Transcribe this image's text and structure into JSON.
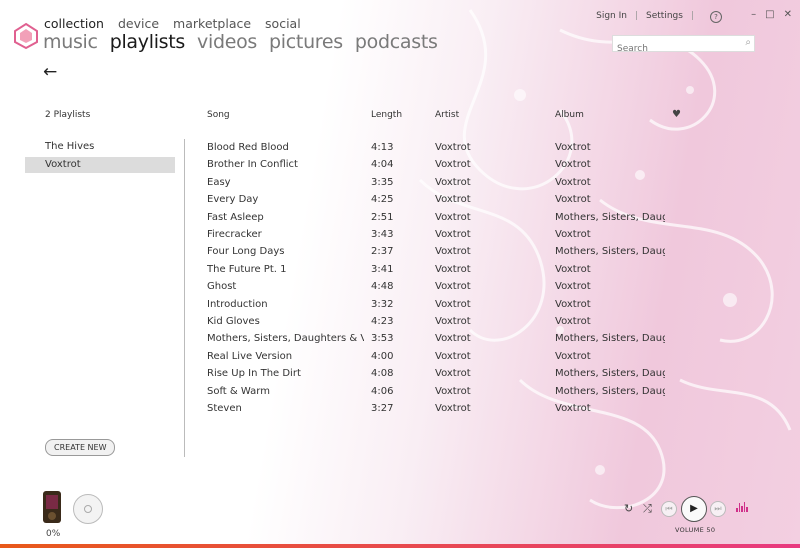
{
  "nav": {
    "pivots": [
      "collection",
      "device",
      "marketplace",
      "social"
    ],
    "subpivots": [
      "music",
      "playlists",
      "videos",
      "pictures",
      "podcasts"
    ],
    "sign_in": "Sign In",
    "settings": "Settings",
    "separator": "|",
    "help": "?",
    "search_placeholder": "Search"
  },
  "headers": {
    "playlist_count": "2 Playlists",
    "song": "Song",
    "length": "Length",
    "artist": "Artist",
    "album": "Album"
  },
  "playlists": [
    "The Hives",
    "Voxtrot"
  ],
  "songs": [
    {
      "song": "Blood Red Blood",
      "length": "4:13",
      "artist": "Voxtrot",
      "album": "Voxtrot"
    },
    {
      "song": "Brother In Conflict",
      "length": "4:04",
      "artist": "Voxtrot",
      "album": "Voxtrot"
    },
    {
      "song": "Easy",
      "length": "3:35",
      "artist": "Voxtrot",
      "album": "Voxtrot"
    },
    {
      "song": "Every Day",
      "length": "4:25",
      "artist": "Voxtrot",
      "album": "Voxtrot"
    },
    {
      "song": "Fast Asleep",
      "length": "2:51",
      "artist": "Voxtrot",
      "album": "Mothers, Sisters, Daug"
    },
    {
      "song": "Firecracker",
      "length": "3:43",
      "artist": "Voxtrot",
      "album": "Voxtrot"
    },
    {
      "song": "Four Long Days",
      "length": "2:37",
      "artist": "Voxtrot",
      "album": "Mothers, Sisters, Daug"
    },
    {
      "song": "The Future Pt. 1",
      "length": "3:41",
      "artist": "Voxtrot",
      "album": "Voxtrot"
    },
    {
      "song": "Ghost",
      "length": "4:48",
      "artist": "Voxtrot",
      "album": "Voxtrot"
    },
    {
      "song": "Introduction",
      "length": "3:32",
      "artist": "Voxtrot",
      "album": "Voxtrot"
    },
    {
      "song": "Kid Gloves",
      "length": "4:23",
      "artist": "Voxtrot",
      "album": "Voxtrot"
    },
    {
      "song": "Mothers, Sisters, Daughters & V",
      "length": "3:53",
      "artist": "Voxtrot",
      "album": "Mothers, Sisters, Daug"
    },
    {
      "song": "Real Live Version",
      "length": "4:00",
      "artist": "Voxtrot",
      "album": "Voxtrot"
    },
    {
      "song": "Rise Up In The Dirt",
      "length": "4:08",
      "artist": "Voxtrot",
      "album": "Mothers, Sisters, Daug"
    },
    {
      "song": "Soft & Warm",
      "length": "4:06",
      "artist": "Voxtrot",
      "album": "Mothers, Sisters, Daug"
    },
    {
      "song": "Steven",
      "length": "3:27",
      "artist": "Voxtrot",
      "album": "Voxtrot"
    }
  ],
  "buttons": {
    "create_new": "CREATE NEW"
  },
  "player": {
    "sync_progress": "0%",
    "volume": "VOLUME 50"
  },
  "icons": {
    "back": "←",
    "heart": "♥",
    "play": "▶",
    "repeat": "↻",
    "shuffle": "⤮",
    "prev": "⏮",
    "next": "⏭",
    "minimize": "–",
    "maximize": "□",
    "close": "✕",
    "search": "⌕"
  },
  "colors": {
    "accent": "#e83a80",
    "selection": "#dcdcdc"
  }
}
